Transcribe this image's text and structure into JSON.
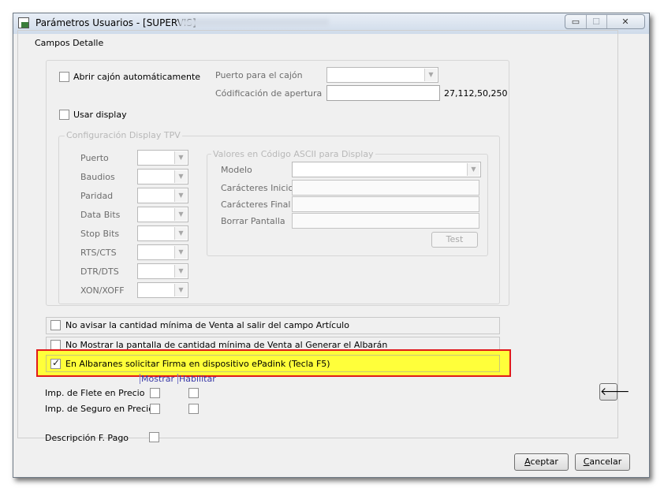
{
  "window": {
    "title": "Parámetros Usuarios - [SUPERVIS]"
  },
  "titlebar_controls": {
    "minimize": "▭",
    "maximize": "☐",
    "close": "✕"
  },
  "panel": {
    "title": "Campos Detalle"
  },
  "cajon": {
    "abrir_label": "Abrir cajón automáticamente",
    "puerto_label": "Puerto para el cajón",
    "puerto_value": "",
    "codificacion_label": "Códificación de apertura",
    "codificacion_value": "",
    "codificacion_hint": "27,112,50,250"
  },
  "display": {
    "usar_label": "Usar display",
    "config_title": "Configuración Display TPV",
    "fields": [
      {
        "label": "Puerto"
      },
      {
        "label": "Baudios"
      },
      {
        "label": "Paridad"
      },
      {
        "label": "Data Bits"
      },
      {
        "label": "Stop Bits"
      },
      {
        "label": "RTS/CTS"
      },
      {
        "label": "DTR/DTS"
      },
      {
        "label": "XON/XOFF"
      }
    ],
    "ascii": {
      "title": "Valores en Código ASCII para Display",
      "modelo_label": "Modelo",
      "inicio_label": "Carácteres Inicio",
      "final_label": "Carácteres Final",
      "borrar_label": "Borrar Pantalla",
      "test_button": "Test"
    }
  },
  "options": {
    "no_avisar": "No avisar la cantidad mínima de Venta al salir del campo Artículo",
    "no_mostrar": "No Mostrar la pantalla de cantidad mínima de Venta al Generar el Albarán",
    "firma": "En Albaranes solicitar Firma en dispositivo ePadink (Tecla F5)",
    "firma_checked": true
  },
  "imp": {
    "mostrar_header": "Mostrar",
    "habilitar_header": "Habilitar",
    "flete_label": "Imp. de Flete en Precio",
    "seguro_label": "Imp. de Seguro en Precio",
    "descripcion_label": "Descripción F. Pago"
  },
  "side": {
    "back_icon": "🡐"
  },
  "footer": {
    "aceptar_first": "A",
    "aceptar_rest": "ceptar",
    "cancelar_first": "C",
    "cancelar_rest": "ancelar"
  },
  "colors": {
    "highlight_fill": "#ffff3a",
    "highlight_border": "#e01a1a"
  }
}
